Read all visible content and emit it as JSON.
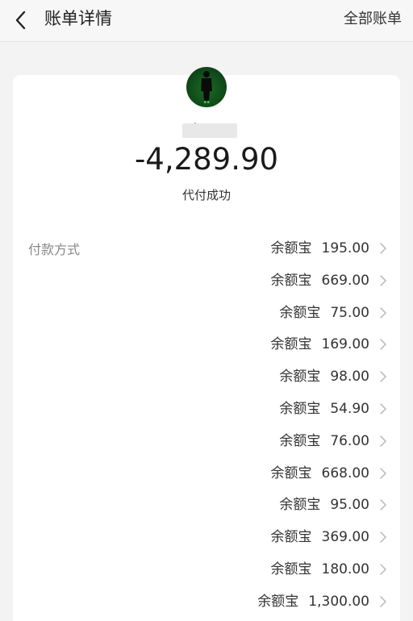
{
  "header": {
    "title": "账单详情",
    "right_link": "全部账单"
  },
  "summary": {
    "amount": "-4,289.90",
    "status": "代付成功"
  },
  "payment": {
    "label": "付款方式",
    "rows": [
      {
        "method": "余额宝",
        "amount": "195.00"
      },
      {
        "method": "余额宝",
        "amount": "669.00"
      },
      {
        "method": "余额宝",
        "amount": "75.00"
      },
      {
        "method": "余额宝",
        "amount": "169.00"
      },
      {
        "method": "余额宝",
        "amount": "98.00"
      },
      {
        "method": "余额宝",
        "amount": "54.90"
      },
      {
        "method": "余额宝",
        "amount": "76.00"
      },
      {
        "method": "余额宝",
        "amount": "668.00"
      },
      {
        "method": "余额宝",
        "amount": "95.00"
      },
      {
        "method": "余额宝",
        "amount": "369.00"
      },
      {
        "method": "余额宝",
        "amount": "180.00"
      },
      {
        "method": "余额宝",
        "amount": "1,300.00"
      }
    ]
  },
  "icons": {
    "back": "chevron-left-icon",
    "row_arrow": "chevron-right-icon",
    "avatar": "user-avatar"
  },
  "colors": {
    "background": "#f3f3f3",
    "card": "#ffffff",
    "avatar_green": "#1b6b26",
    "text_primary": "#1a1a1a",
    "text_secondary": "#888888"
  }
}
